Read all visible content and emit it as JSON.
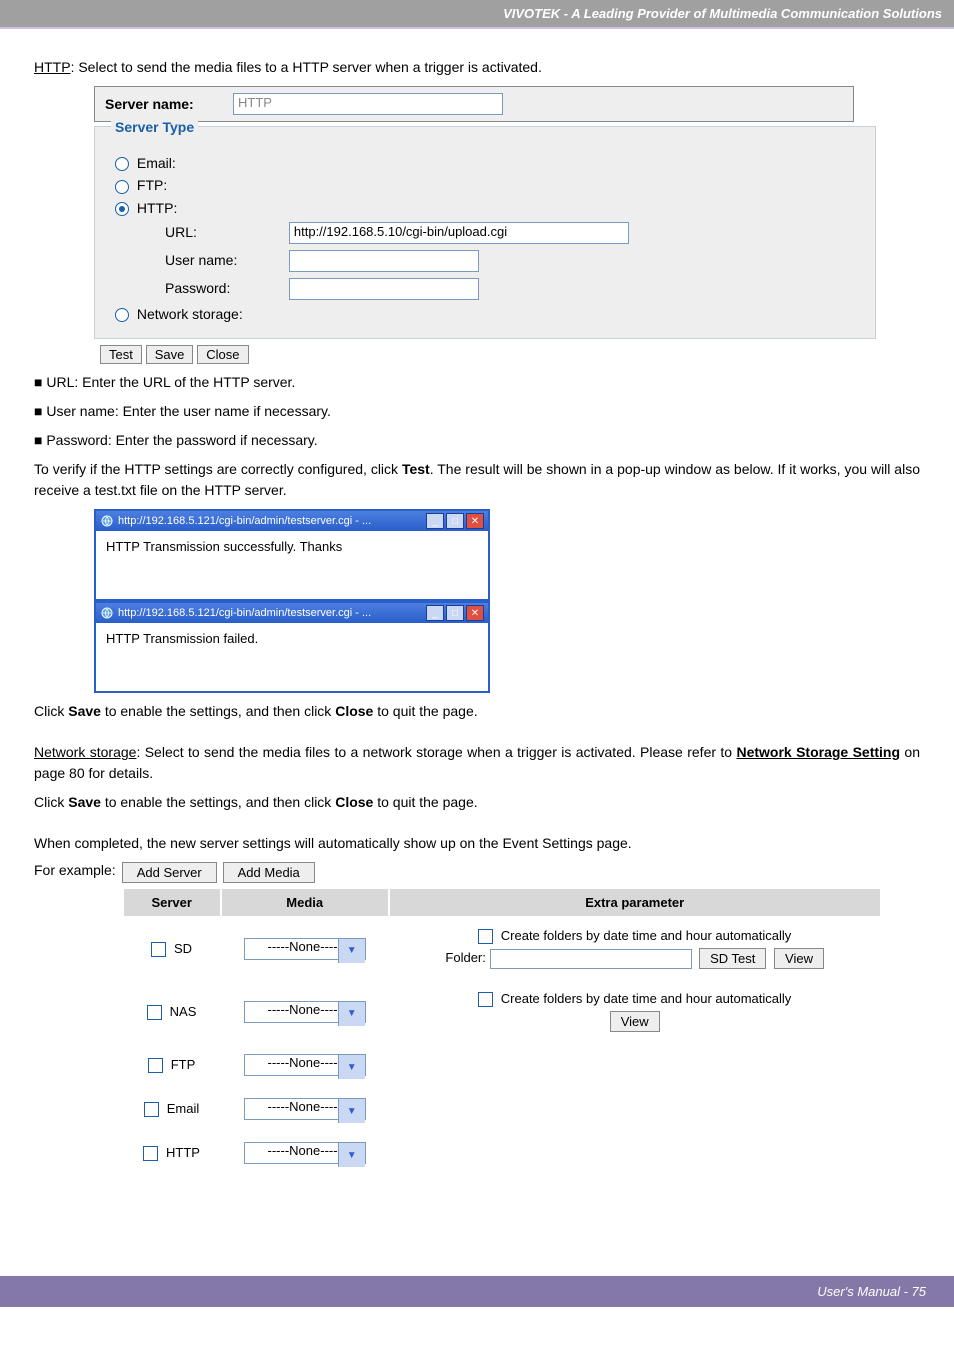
{
  "banner": "VIVOTEK - A Leading Provider of Multimedia Communication Solutions",
  "http_section": {
    "intro_prefix": "HTTP",
    "intro": ": Select to send the media files to a HTTP server when a trigger is activated.",
    "server_name_label": "Server name:",
    "server_name_value": "HTTP",
    "legend": "Server Type",
    "opt_email": "Email:",
    "opt_ftp": "FTP:",
    "opt_http": "HTTP:",
    "url_label": "URL:",
    "url_value": "http://192.168.5.10/cgi-bin/upload.cgi",
    "user_label": "User name:",
    "pass_label": "Password:",
    "opt_ns": "Network storage:",
    "btn_test": "Test",
    "btn_save": "Save",
    "btn_close": "Close"
  },
  "bullets": {
    "url": "■ URL: Enter the URL of the HTTP server.",
    "user": "■ User name: Enter the user name if necessary.",
    "pass": "■ Password: Enter the password if necessary."
  },
  "verify": {
    "p1a": "To verify if the HTTP settings are correctly configured, click ",
    "p1b": "Test",
    "p1c": ". The result will be shown in a pop-up window as below. If it works, you will also receive a test.txt file on the HTTP server.",
    "popup_title": "http://192.168.5.121/cgi-bin/admin/testserver.cgi - ...",
    "popup_ok": "HTTP Transmission successfully. Thanks",
    "popup_fail": "HTTP Transmission failed."
  },
  "save1": {
    "a": "Click ",
    "b": "Save",
    "c": " to enable the settings,  and then click ",
    "d": "Close",
    "e": " to quit the page."
  },
  "ns": {
    "prefix": "Network storage",
    "body": ": Select to send the media files to a network storage when a trigger is activated. Please refer to ",
    "link": "Network Storage Setting",
    "suffix": " on page 80 for details."
  },
  "save2": {
    "a": "Click ",
    "b": "Save",
    "c": " to enable the settings,  and then click ",
    "d": "Close",
    "e": " to quit the page."
  },
  "completed": {
    "p": "When completed, the new server settings will automatically show up on the Event Settings page.",
    "for_ex": "For example:"
  },
  "ev_table": {
    "btn_add_server": "Add Server",
    "btn_add_media": "Add Media",
    "hdr_server": "Server",
    "hdr_media": "Media",
    "hdr_extra": "Extra parameter",
    "none": "-----None-----",
    "r1_label": "SD",
    "r1_auto": "Create folders by date time and hour automatically",
    "r1_folder": "Folder:",
    "r1_sdtest": "SD Test",
    "r1_view": "View",
    "r2_label": "NAS",
    "r2_auto": "Create folders by date time and hour automatically",
    "r2_view": "View",
    "r3_label": "FTP",
    "r4_label": "Email",
    "r5_label": "HTTP"
  },
  "footer": "User's Manual - 75"
}
